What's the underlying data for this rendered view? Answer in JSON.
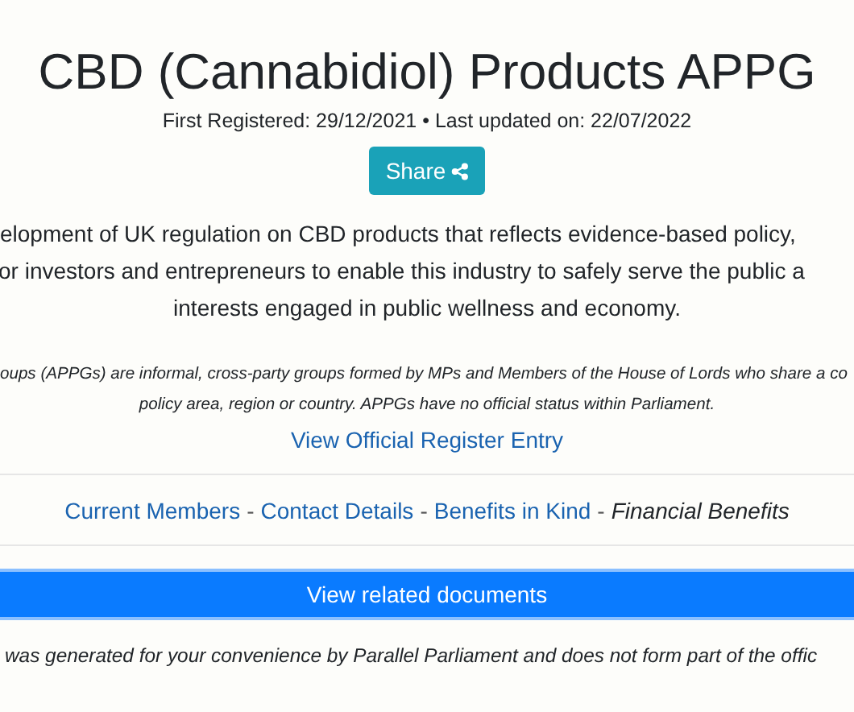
{
  "title": "CBD (Cannabidiol) Products APPG",
  "meta": "First Registered: 29/12/2021 • Last updated on: 22/07/2022",
  "share_button": "Share",
  "purpose_lines": [
    "elopment of UK regulation on CBD products that reflects evidence-based policy,",
    "or investors and entrepreneurs to enable this industry to safely serve the public a",
    "interests engaged in public wellness and economy."
  ],
  "disclaimer_lines": [
    "oups (APPGs) are informal, cross-party groups formed by MPs and Members of the House of Lords who share a co",
    "policy area, region or country. APPGs have no official status within Parliament."
  ],
  "register_link": "View Official Register Entry",
  "nav": [
    {
      "label": "Current Members",
      "selected": false
    },
    {
      "label": "Contact Details",
      "selected": false
    },
    {
      "label": "Benefits in Kind",
      "selected": false
    },
    {
      "label": "Financial Benefits",
      "selected": true
    }
  ],
  "nav_separator": "-",
  "documents_button": "View related documents",
  "footer": "was generated for your convenience by Parallel Parliament and does not form part of the offic"
}
